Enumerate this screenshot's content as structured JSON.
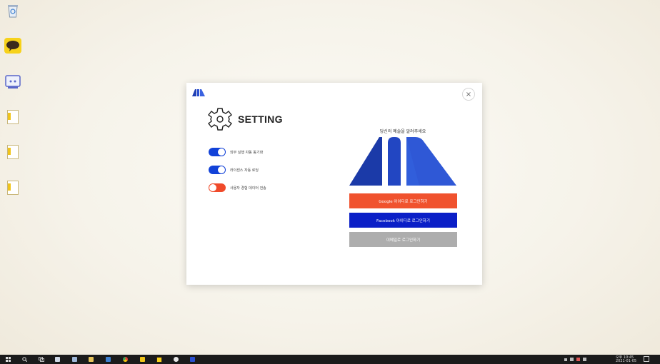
{
  "desktop": {
    "icons": [
      "recycle-bin-icon",
      "kakaotalk-icon",
      "discord-icon",
      "file-icon",
      "file-icon",
      "file-icon"
    ]
  },
  "dialog": {
    "close_label": "×",
    "setting_title": "SETTING",
    "toggles": [
      {
        "label": "외부 실행 자동 동기화",
        "state": "on"
      },
      {
        "label": "라이센스 자동 로딩",
        "state": "on"
      },
      {
        "label": "사용자 경험 데이터 전송",
        "state": "off"
      }
    ],
    "prompt": "당신의 예술을 알려주세요",
    "buttons": {
      "google": "Google 아이디로 로그인하기",
      "facebook": "Facebook 아이디로 로그인하기",
      "email": "이메일로 로그인하기"
    },
    "colors": {
      "toggle_on": "#1242d8",
      "toggle_off": "#f04a2a",
      "google_button": "#f0522e",
      "facebook_button": "#0b1fc7",
      "email_button": "#adadad",
      "logo_blue": "#1f3fb4"
    }
  },
  "taskbar": {
    "clock_time": "오후 10:45",
    "clock_date": "2021-01-05"
  }
}
